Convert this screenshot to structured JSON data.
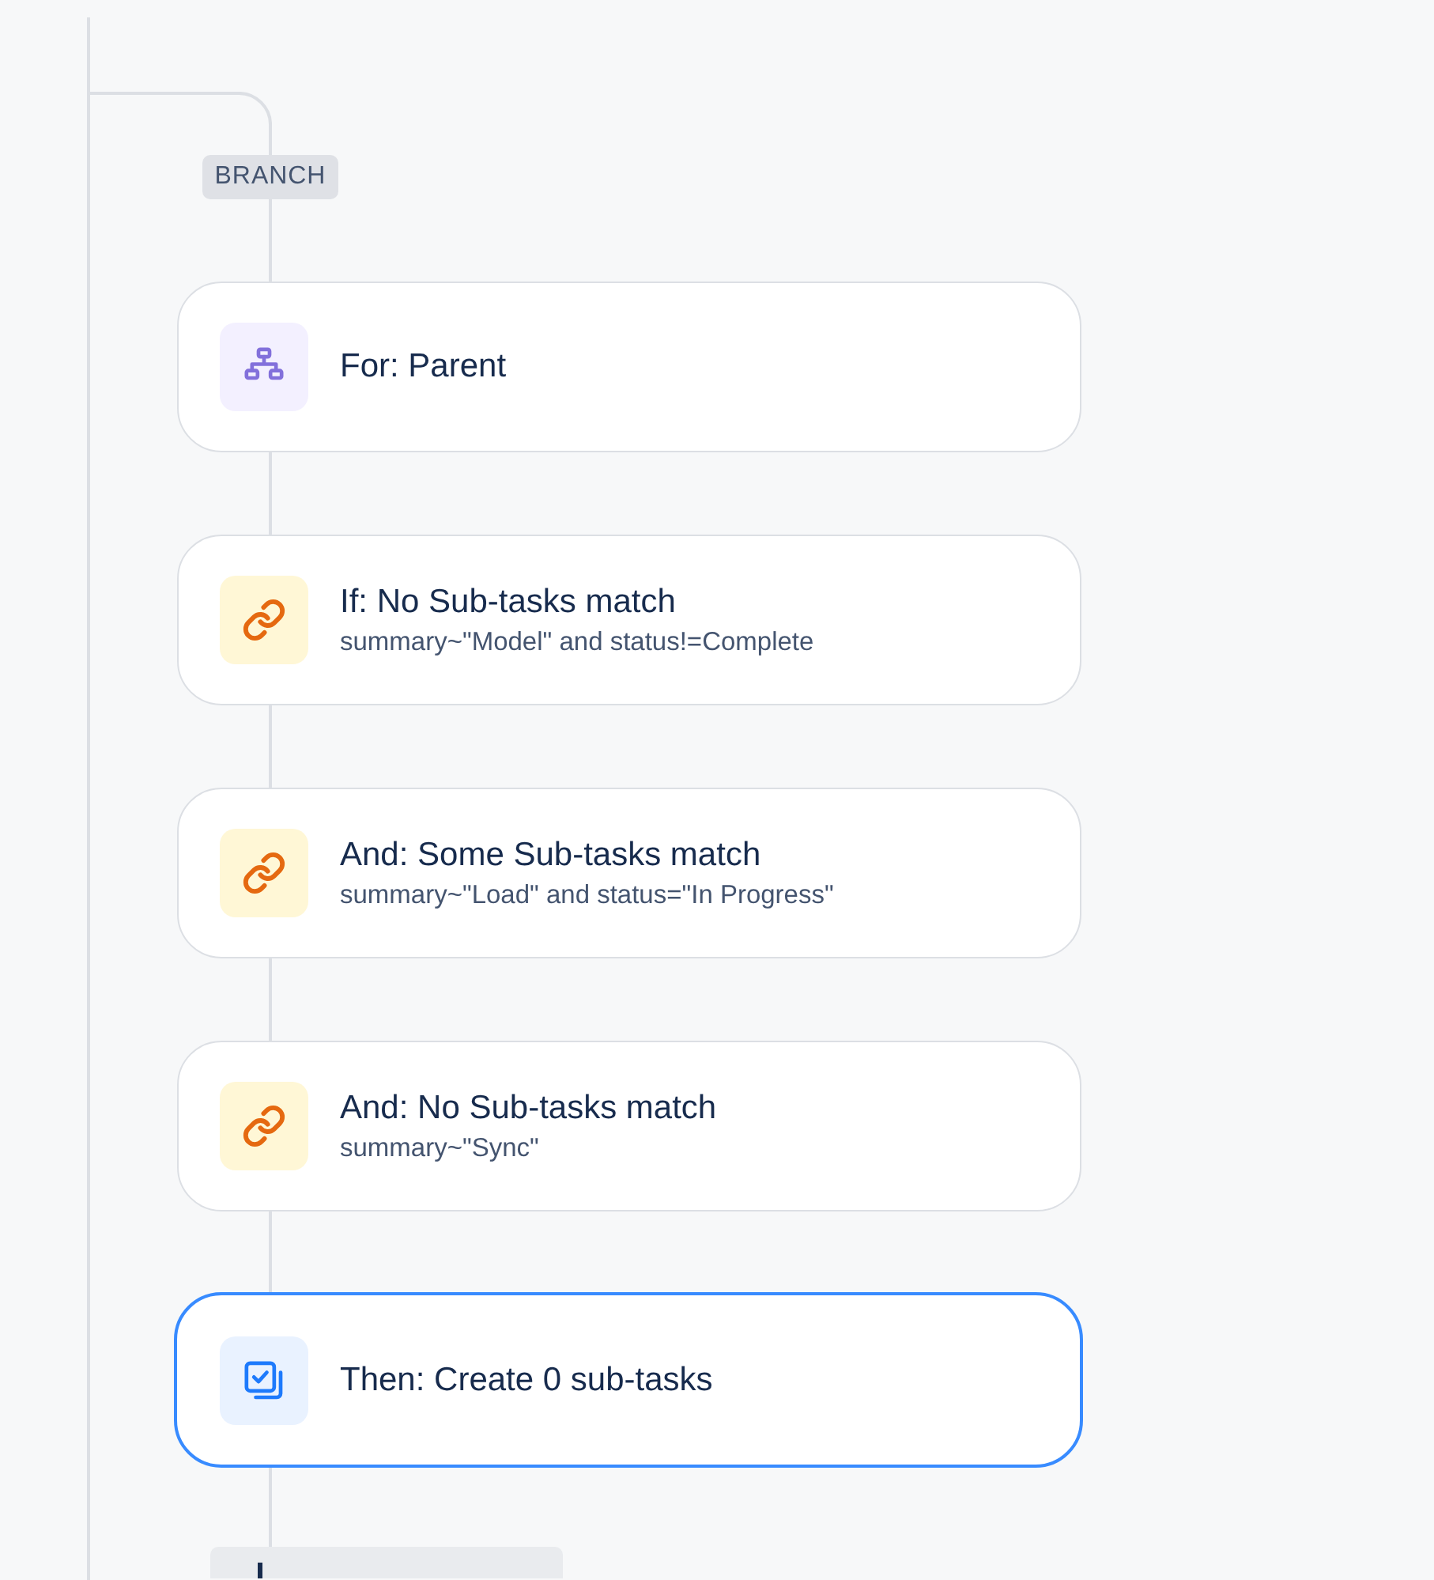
{
  "flow": {
    "branch_label": "BRANCH",
    "steps": [
      {
        "kind": "for",
        "title": "For: Parent",
        "selected": false
      },
      {
        "kind": "condition",
        "title": "If: No Sub-tasks match",
        "subtitle": "summary~\"Model\" and status!=Complete",
        "selected": false
      },
      {
        "kind": "condition",
        "title": "And: Some Sub-tasks match",
        "subtitle": "summary~\"Load\" and status=\"In Progress\"",
        "selected": false
      },
      {
        "kind": "condition",
        "title": "And: No Sub-tasks match",
        "subtitle": "summary~\"Sync\"",
        "selected": false
      },
      {
        "kind": "action",
        "title": "Then: Create 0 sub-tasks",
        "selected": true
      }
    ]
  }
}
